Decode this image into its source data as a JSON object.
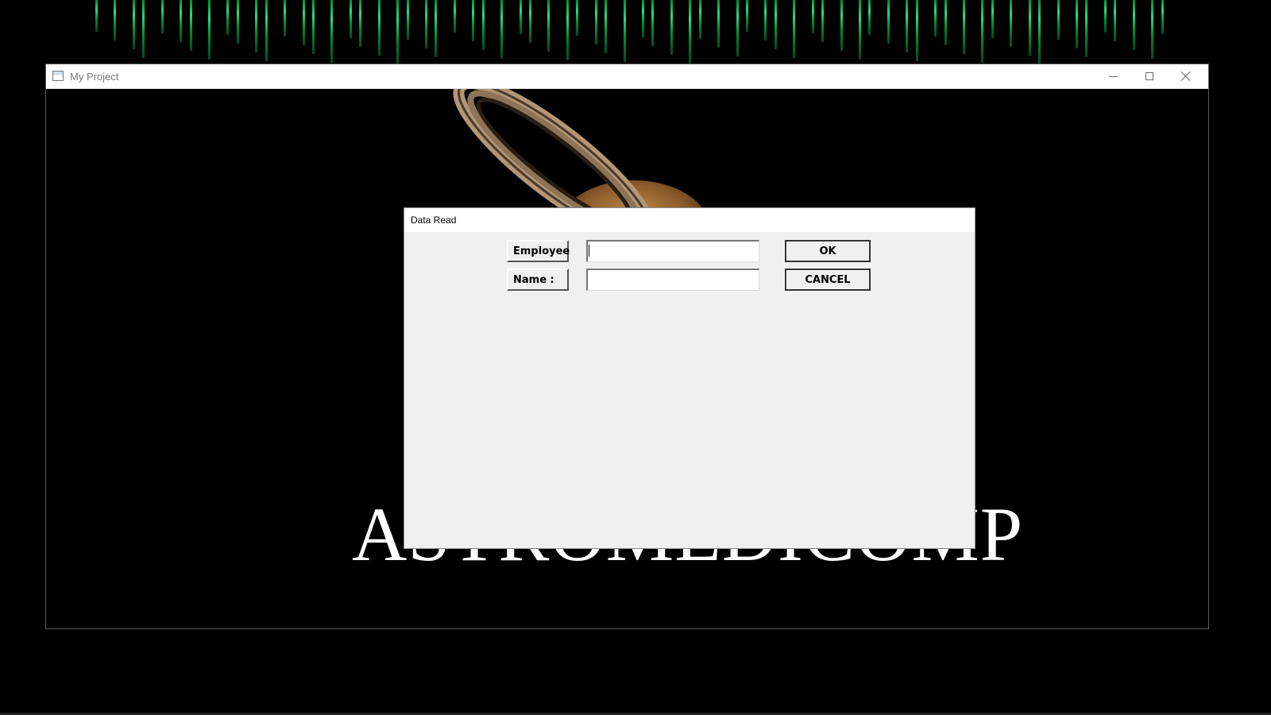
{
  "app_window": {
    "title": "My Project",
    "brand_text": "ASTROMEDICOMP"
  },
  "dialog": {
    "title": "Data Read",
    "fields": {
      "employee_label": "Employee",
      "employee_value": "",
      "name_label": "Name :",
      "name_value": ""
    },
    "buttons": {
      "ok": "OK",
      "cancel": "CANCEL"
    }
  },
  "colors": {
    "desktop_bg": "#000000",
    "matrix_green": "#33ff99",
    "dialog_bg": "#f0f0f0"
  },
  "icons": {
    "app_icon": "window-app-icon",
    "minimize": "minimize-icon",
    "maximize": "maximize-icon",
    "close": "close-icon"
  }
}
